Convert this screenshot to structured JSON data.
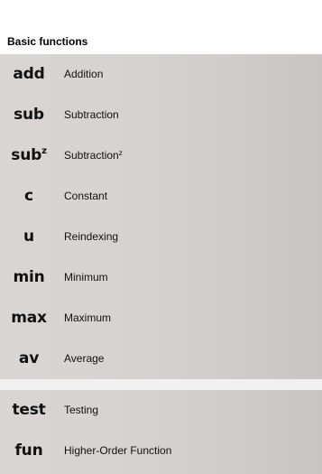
{
  "section": {
    "title": "Basic functions"
  },
  "groups": [
    {
      "items": [
        {
          "symbol": "add",
          "label": "Addition"
        },
        {
          "symbol": "sub",
          "label": "Subtraction"
        },
        {
          "symbol": "sub",
          "symbol_sup": "z",
          "label": "Subtraction",
          "label_sup": "z"
        },
        {
          "symbol": "c",
          "label": "Constant"
        },
        {
          "symbol": "u",
          "label": "Reindexing"
        },
        {
          "symbol": "min",
          "label": "Minimum"
        },
        {
          "symbol": "max",
          "label": "Maximum"
        },
        {
          "symbol": "av",
          "label": "Average"
        }
      ]
    },
    {
      "items": [
        {
          "symbol": "test",
          "label": "Testing"
        },
        {
          "symbol": "fun",
          "label": "Higher-Order Function"
        }
      ]
    }
  ],
  "colors": {
    "item_background": "#d6d2d1",
    "divider": "#f2f1f1",
    "text": "#111111"
  }
}
